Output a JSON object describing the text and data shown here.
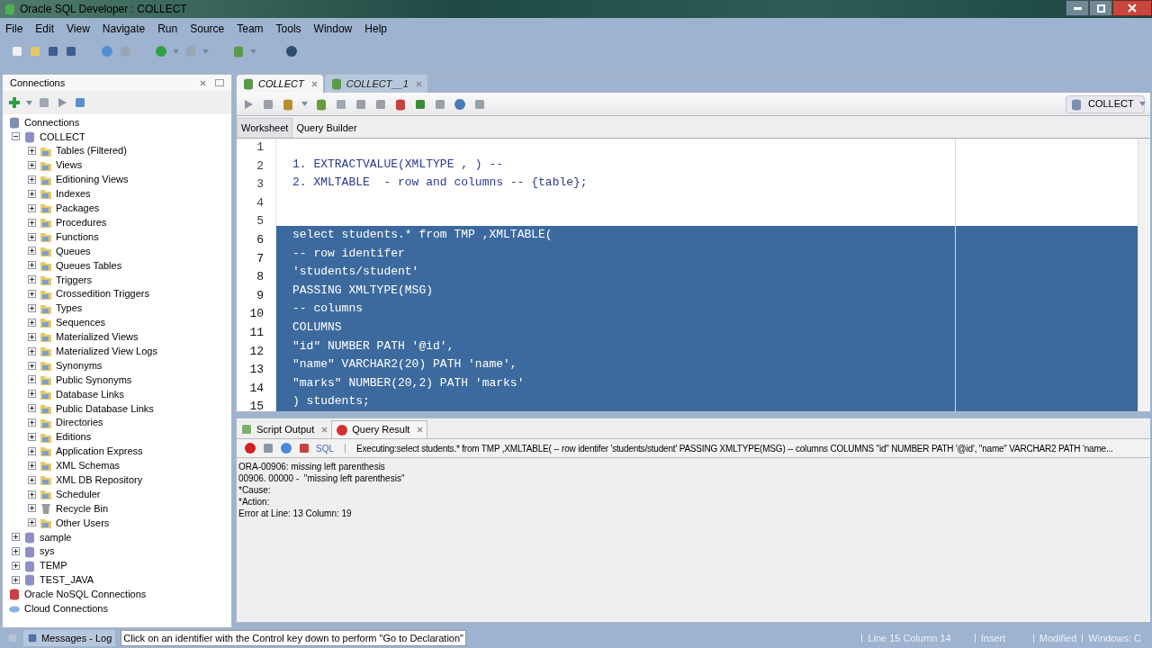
{
  "window": {
    "title": "Oracle SQL Developer : COLLECT"
  },
  "menu": [
    "File",
    "Edit",
    "View",
    "Navigate",
    "Run",
    "Source",
    "Team",
    "Tools",
    "Window",
    "Help"
  ],
  "connections_panel": {
    "title": "Connections",
    "tree": [
      {
        "label": "Connections",
        "kind": "root",
        "children": [
          {
            "label": "COLLECT",
            "kind": "db",
            "expanded": true,
            "children": [
              {
                "label": "Tables (Filtered)",
                "kind": "folder",
                "expanded": false
              },
              {
                "label": "Views",
                "kind": "folder",
                "expanded": false
              },
              {
                "label": "Editioning Views",
                "kind": "folder",
                "expanded": false
              },
              {
                "label": "Indexes",
                "kind": "folder",
                "expanded": false
              },
              {
                "label": "Packages",
                "kind": "folder",
                "expanded": false
              },
              {
                "label": "Procedures",
                "kind": "folder",
                "expanded": false
              },
              {
                "label": "Functions",
                "kind": "folder",
                "expanded": false
              },
              {
                "label": "Queues",
                "kind": "folder",
                "expanded": false
              },
              {
                "label": "Queues Tables",
                "kind": "folder",
                "expanded": false
              },
              {
                "label": "Triggers",
                "kind": "folder",
                "expanded": false
              },
              {
                "label": "Crossedition Triggers",
                "kind": "folder",
                "expanded": false
              },
              {
                "label": "Types",
                "kind": "folder",
                "expanded": false
              },
              {
                "label": "Sequences",
                "kind": "folder",
                "expanded": false
              },
              {
                "label": "Materialized Views",
                "kind": "folder",
                "expanded": false
              },
              {
                "label": "Materialized View Logs",
                "kind": "folder",
                "expanded": false
              },
              {
                "label": "Synonyms",
                "kind": "folder",
                "expanded": false
              },
              {
                "label": "Public Synonyms",
                "kind": "folder",
                "expanded": false
              },
              {
                "label": "Database Links",
                "kind": "folder",
                "expanded": false
              },
              {
                "label": "Public Database Links",
                "kind": "folder",
                "expanded": false
              },
              {
                "label": "Directories",
                "kind": "folder",
                "expanded": false
              },
              {
                "label": "Editions",
                "kind": "folder",
                "expanded": false
              },
              {
                "label": "Application Express",
                "kind": "folder",
                "expanded": false
              },
              {
                "label": "XML Schemas",
                "kind": "folder",
                "expanded": false
              },
              {
                "label": "XML DB Repository",
                "kind": "folder",
                "expanded": false
              },
              {
                "label": "Scheduler",
                "kind": "folder",
                "expanded": false
              },
              {
                "label": "Recycle Bin",
                "kind": "bin",
                "expanded": false
              },
              {
                "label": "Other Users",
                "kind": "folder",
                "expanded": false
              }
            ]
          },
          {
            "label": "sample",
            "kind": "db",
            "expanded": false
          },
          {
            "label": "sys",
            "kind": "db",
            "expanded": false
          },
          {
            "label": "TEMP",
            "kind": "db",
            "expanded": false
          },
          {
            "label": "TEST_JAVA",
            "kind": "db",
            "expanded": false
          }
        ]
      },
      {
        "label": "Oracle NoSQL Connections",
        "kind": "nosql"
      },
      {
        "label": "Cloud Connections",
        "kind": "cloud"
      }
    ]
  },
  "editor_tabs": [
    {
      "label": "COLLECT",
      "selected": true
    },
    {
      "label": "COLLECT__1",
      "selected": false
    }
  ],
  "connection_selector": {
    "value": "COLLECT"
  },
  "sub_tabs": [
    {
      "label": "Worksheet",
      "selected": true
    },
    {
      "label": "Query Builder",
      "selected": false
    }
  ],
  "code_lines": [
    {
      "number": "1",
      "selected": false
    },
    {
      "number": "2",
      "text": "1. EXTRACTVALUE(XMLTYPE , ) --",
      "selected": false
    },
    {
      "number": "3",
      "text": "2. XMLTABLE  - row and columns -- {table};",
      "selected": false
    },
    {
      "number": "4",
      "selected": false
    },
    {
      "number": "5",
      "selected": false
    },
    {
      "number": "6",
      "text": "select students.* from TMP ,XMLTABLE(",
      "selected": true
    },
    {
      "number": "7",
      "text": "-- row identifer",
      "selected": true
    },
    {
      "number": "8",
      "text": "'students/student'",
      "selected": true
    },
    {
      "number": "9",
      "text": "PASSING XMLTYPE(MSG)",
      "selected": true
    },
    {
      "number": "10",
      "text": "-- columns",
      "selected": true
    },
    {
      "number": "11",
      "text": "COLUMNS",
      "selected": true
    },
    {
      "number": "12",
      "text": "\"id\" NUMBER PATH '@id',",
      "selected": true
    },
    {
      "number": "13",
      "text": "\"name\" VARCHAR2(20) PATH 'name',",
      "selected": true
    },
    {
      "number": "14",
      "text": "\"marks\" NUMBER(20,2) PATH 'marks'",
      "selected": true
    },
    {
      "number": "15",
      "text": ") students;",
      "selected": true
    }
  ],
  "output_tabs": [
    {
      "label": "Script Output",
      "selected": false
    },
    {
      "label": "Query Result",
      "selected": true
    }
  ],
  "output_toolbar": {
    "sql_label": "SQL",
    "executing": "Executing:select students.* from TMP ,XMLTABLE(  -- row identifer  'students/student'  PASSING XMLTYPE(MSG)  -- columns   COLUMNS  \"id\" NUMBER PATH '@id',   \"name\" VARCHAR2 PATH 'name..."
  },
  "output_lines": [
    "ORA-00906: missing left parenthesis",
    "00906. 00000 -  \"missing left parenthesis\"",
    "*Cause:",
    "*Action:",
    "Error at Line: 13 Column: 19"
  ],
  "status_bar": {
    "messages_tab": "Messages - Log",
    "hint": "Click on an identifier with the Control key down to perform \"Go to Declaration\"",
    "position": "Line 15 Column 14",
    "mode": "Insert",
    "modified": "Modified",
    "platform": "Windows: C"
  }
}
